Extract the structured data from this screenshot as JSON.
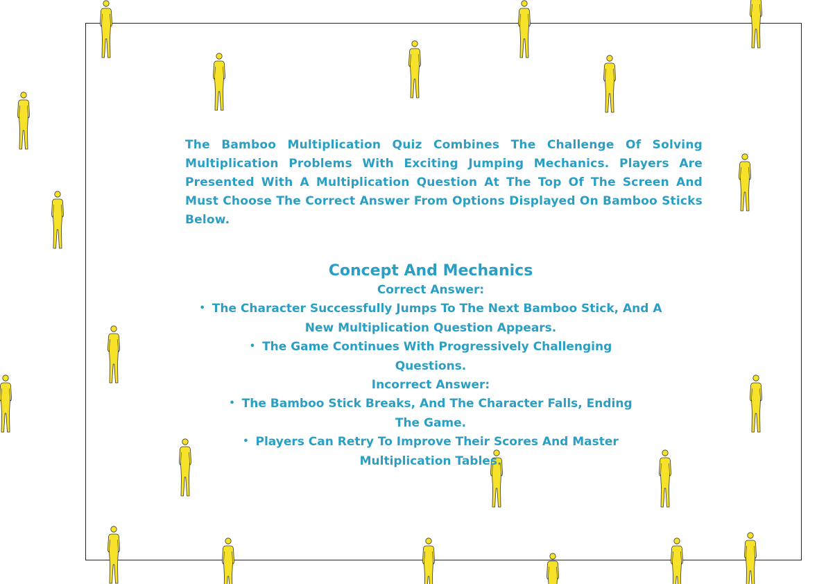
{
  "colors": {
    "text": "#2a9fc4",
    "figure_fill": "#f7e22a",
    "figure_stroke": "#333333",
    "frame_border": "#222222"
  },
  "decoration": {
    "figure_icon": "standing-person-icon",
    "figure_count": 27
  },
  "intro": {
    "text": "The Bamboo Multiplication Quiz Combines The Challenge Of Solving Multiplication Problems With Exciting Jumping Mechanics. Players Are Presented With A Multiplication Question At The Top Of The Screen And Must Choose The Correct Answer From Options Displayed On Bamboo Sticks Below."
  },
  "concept": {
    "title": "Concept And Mechanics",
    "correct_heading": "Correct Answer:",
    "correct_items": [
      "The Character Successfully Jumps To The Next Bamboo Stick, And A New Multiplication Question Appears.",
      "The Game Continues With Progressively Challenging Questions."
    ],
    "incorrect_heading": "Incorrect Answer:",
    "incorrect_items": [
      "The Bamboo Stick Breaks, And The Character Falls, Ending The Game.",
      "Players Can Retry To Improve Their Scores And Master Multiplication Tables."
    ]
  }
}
